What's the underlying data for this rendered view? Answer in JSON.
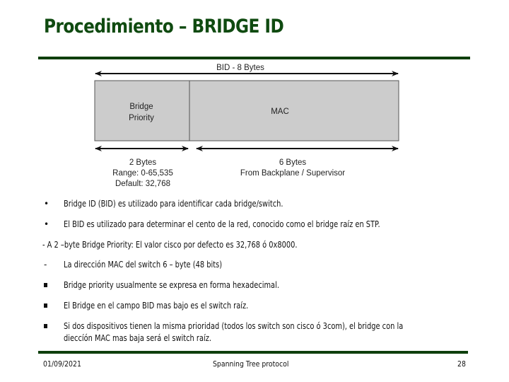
{
  "slide": {
    "title": "Procedimiento – BRIDGE ID",
    "accent_color": "#0e3f0c",
    "title_color": "#0f4a10"
  },
  "diagram": {
    "total_label": "BID - 8 Bytes",
    "fields": [
      {
        "name_line1": "Bridge",
        "name_line2": "Priority",
        "size_label": "2 Bytes",
        "detail_line1": "Range: 0-65,535",
        "detail_line2": "Default: 32,768"
      },
      {
        "name_line1": "MAC",
        "size_label": "6 Bytes",
        "detail_line1": "From Backplane / Supervisor"
      }
    ],
    "box_fill": "#cccccc"
  },
  "content": {
    "items": [
      {
        "bullet": "•",
        "text": "Bridge ID (BID) es utilizado para identificar cada bridge/switch."
      },
      {
        "bullet": "•",
        "text": "El BID es utilizado para determinar el cento de la red, conocido como el bridge raíz en STP."
      },
      {
        "bullet": "",
        "text": "- A 2 –byte Bridge Priority: El valor cisco por defecto es 32,768 ó 0x8000."
      },
      {
        "bullet": "-",
        "text": "La dirección MAC del switch 6 – byte (48 bits)"
      },
      {
        "bullet": "square",
        "text": " Bridge priority usualmente se expresa en forma hexadecimal."
      },
      {
        "bullet": "square",
        "text": "El Bridge en el campo BID mas bajo es el switch raíz."
      },
      {
        "bullet": "square",
        "text_line1": "Si dos dispositivos tienen la misma prioridad (todos los switch son cisco ó 3com), el bridge con la",
        "text_line2": "dieccíón MAC mas baja será el switch raíz."
      }
    ]
  },
  "footer": {
    "date": "01/09/2021",
    "topic": "Spanning Tree protocol",
    "page_number": "28"
  }
}
